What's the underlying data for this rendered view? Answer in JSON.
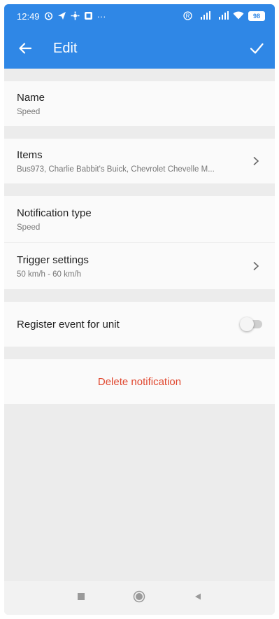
{
  "status": {
    "time": "12:49",
    "left_icons": [
      "alarm-icon",
      "send-icon",
      "app-icon",
      "app-icon"
    ],
    "more": "···",
    "battery": "98"
  },
  "appbar": {
    "title": "Edit"
  },
  "sections": {
    "name": {
      "label": "Name",
      "value": "Speed"
    },
    "items": {
      "label": "Items",
      "value": "Bus973, Charlie Babbit's Buick, Chevrolet Chevelle M..."
    },
    "notification_type": {
      "label": "Notification type",
      "value": "Speed"
    },
    "trigger_settings": {
      "label": "Trigger settings",
      "value": "50 km/h - 60 km/h"
    },
    "register_event": {
      "label": "Register event for unit",
      "enabled": false
    }
  },
  "actions": {
    "delete_label": "Delete notification"
  },
  "colors": {
    "primary": "#2f87e6",
    "danger": "#e0472f",
    "background": "#ececec"
  }
}
